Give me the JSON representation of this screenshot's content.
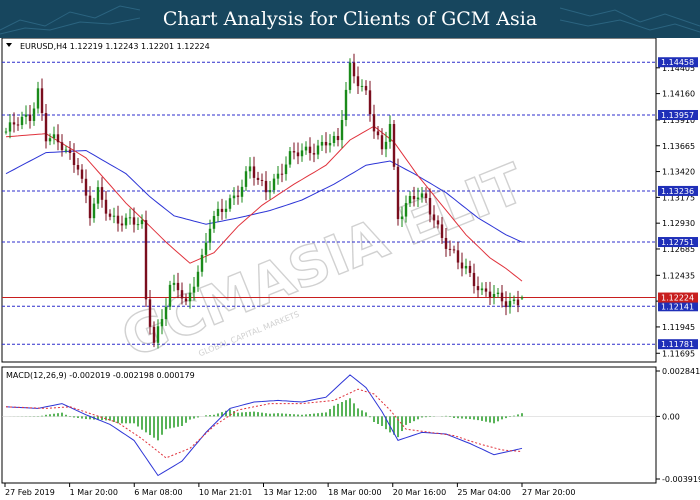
{
  "header": {
    "title": "Chart Analysis for Clients of GCM Asia"
  },
  "watermark": {
    "text": "GCMASIA ELIT",
    "sub": "GLOBAL CAPITAL MARKETS"
  },
  "colors": {
    "banner": "#17465e",
    "bull": "#1a8a1a",
    "bear": "#7a0e1e",
    "ma_fast": "#e0323c",
    "ma_slow": "#2d35d6",
    "level_line": "#2d2dcc",
    "price_line": "#c81e1e",
    "level_label_bg": "#1f2fb8",
    "price_label_bg": "#c81e1e",
    "macd_hist": "#2ea02e",
    "macd_signal": "#e0323c",
    "macd_main": "#2d35d6"
  },
  "chart_data": [
    {
      "type": "candlestick",
      "header": "EURUSD,H4  1.12219 1.12243 1.12201 1.12224",
      "symbol": "EURUSD",
      "timeframe": "H4",
      "ohlc_last": {
        "open": 1.12219,
        "high": 1.12243,
        "low": 1.12201,
        "close": 1.12224
      },
      "ylim": [
        1.1165,
        1.1465
      ],
      "y_ticks": [
        "1.14405",
        "1.14160",
        "1.13910",
        "1.13665",
        "1.13420",
        "1.13175",
        "1.12930",
        "1.12685",
        "1.12435",
        "1.12190",
        "1.11945",
        "1.11695"
      ],
      "x_labels": [
        "27 Feb 2019",
        "1 Mar 20:00",
        "6 Mar 08:00",
        "10 Mar 21:01",
        "13 Mar 12:00",
        "18 Mar 00:00",
        "20 Mar 16:00",
        "25 Mar 04:00",
        "27 Mar 20:00"
      ],
      "levels": [
        {
          "price": 1.14458,
          "label": "1.14458"
        },
        {
          "price": 1.13957,
          "label": "1.13957"
        },
        {
          "price": 1.13236,
          "label": "1.13236"
        },
        {
          "price": 1.12751,
          "label": "1.12751"
        },
        {
          "price": 1.12141,
          "label": "1.12141"
        },
        {
          "price": 1.11781,
          "label": "1.11781"
        }
      ],
      "current_price": {
        "price": 1.12224,
        "label": "1.12224"
      },
      "candle_count": 130,
      "price_path": [
        [
          0,
          1.138
        ],
        [
          6,
          1.1395
        ],
        [
          8,
          1.142
        ],
        [
          10,
          1.1375
        ],
        [
          14,
          1.1365
        ],
        [
          18,
          1.135
        ],
        [
          21,
          1.13
        ],
        [
          23,
          1.132
        ],
        [
          26,
          1.13
        ],
        [
          30,
          1.1295
        ],
        [
          34,
          1.129
        ],
        [
          35,
          1.122
        ],
        [
          37,
          1.1182
        ],
        [
          39,
          1.1205
        ],
        [
          41,
          1.123
        ],
        [
          43,
          1.123
        ],
        [
          45,
          1.1215
        ],
        [
          47,
          1.124
        ],
        [
          49,
          1.126
        ],
        [
          51,
          1.129
        ],
        [
          53,
          1.13
        ],
        [
          55,
          1.131
        ],
        [
          57,
          1.132
        ],
        [
          59,
          1.133
        ],
        [
          61,
          1.1345
        ],
        [
          63,
          1.133
        ],
        [
          65,
          1.1325
        ],
        [
          68,
          1.134
        ],
        [
          71,
          1.1355
        ],
        [
          74,
          1.136
        ],
        [
          77,
          1.1365
        ],
        [
          80,
          1.137
        ],
        [
          83,
          1.1368
        ],
        [
          85,
          1.142
        ],
        [
          86,
          1.1443
        ],
        [
          88,
          1.143
        ],
        [
          90,
          1.1415
        ],
        [
          92,
          1.138
        ],
        [
          94,
          1.136
        ],
        [
          96,
          1.139
        ],
        [
          98,
          1.13
        ],
        [
          100,
          1.131
        ],
        [
          103,
          1.1318
        ],
        [
          105,
          1.1315
        ],
        [
          107,
          1.13
        ],
        [
          109,
          1.128
        ],
        [
          111,
          1.1265
        ],
        [
          113,
          1.1255
        ],
        [
          115,
          1.125
        ],
        [
          117,
          1.124
        ],
        [
          119,
          1.1228
        ],
        [
          121,
          1.1225
        ],
        [
          123,
          1.122
        ],
        [
          125,
          1.1218
        ],
        [
          127,
          1.122
        ],
        [
          129,
          1.1222
        ]
      ],
      "ma_fast": [
        [
          0,
          1.1375
        ],
        [
          10,
          1.1378
        ],
        [
          20,
          1.1355
        ],
        [
          30,
          1.1312
        ],
        [
          36,
          1.129
        ],
        [
          40,
          1.1275
        ],
        [
          46,
          1.1255
        ],
        [
          52,
          1.1265
        ],
        [
          58,
          1.129
        ],
        [
          64,
          1.131
        ],
        [
          72,
          1.133
        ],
        [
          80,
          1.1348
        ],
        [
          86,
          1.1372
        ],
        [
          92,
          1.1385
        ],
        [
          97,
          1.137
        ],
        [
          103,
          1.1338
        ],
        [
          109,
          1.131
        ],
        [
          115,
          1.1282
        ],
        [
          121,
          1.126
        ],
        [
          125,
          1.125
        ],
        [
          129,
          1.1238
        ]
      ],
      "ma_slow": [
        [
          0,
          1.134
        ],
        [
          10,
          1.136
        ],
        [
          20,
          1.1362
        ],
        [
          30,
          1.134
        ],
        [
          36,
          1.1318
        ],
        [
          42,
          1.13
        ],
        [
          50,
          1.1292
        ],
        [
          58,
          1.1298
        ],
        [
          66,
          1.1305
        ],
        [
          74,
          1.1315
        ],
        [
          82,
          1.133
        ],
        [
          90,
          1.1348
        ],
        [
          96,
          1.1352
        ],
        [
          102,
          1.134
        ],
        [
          110,
          1.1322
        ],
        [
          118,
          1.1298
        ],
        [
          125,
          1.1282
        ],
        [
          129,
          1.1275
        ]
      ]
    },
    {
      "type": "macd",
      "header": "MACD(12,26,9) -0.002019 -0.002198 0.000179",
      "params": "12,26,9",
      "values": {
        "main": -0.002019,
        "signal": -0.002198,
        "histogram": 0.000179
      },
      "ylim": [
        -0.003919,
        0.002841
      ],
      "y_ticks": [
        "0.002841",
        "0.00",
        "-0.003919"
      ],
      "main": [
        [
          0,
          0.0006
        ],
        [
          8,
          0.0005
        ],
        [
          14,
          0.0008
        ],
        [
          20,
          0.0001
        ],
        [
          26,
          -0.0005
        ],
        [
          32,
          -0.0015
        ],
        [
          38,
          -0.0037
        ],
        [
          44,
          -0.0028
        ],
        [
          50,
          -0.001
        ],
        [
          56,
          0.0005
        ],
        [
          62,
          0.0009
        ],
        [
          68,
          0.001
        ],
        [
          74,
          0.0009
        ],
        [
          80,
          0.0012
        ],
        [
          86,
          0.0026
        ],
        [
          90,
          0.0018
        ],
        [
          94,
          0.0003
        ],
        [
          98,
          -0.0015
        ],
        [
          104,
          -0.001
        ],
        [
          110,
          -0.0011
        ],
        [
          116,
          -0.0017
        ],
        [
          122,
          -0.0024
        ],
        [
          129,
          -0.002
        ]
      ],
      "signal": [
        [
          0,
          0.0006
        ],
        [
          10,
          0.0005
        ],
        [
          16,
          0.0006
        ],
        [
          22,
          0.0001
        ],
        [
          28,
          -0.0004
        ],
        [
          34,
          -0.0014
        ],
        [
          40,
          -0.0026
        ],
        [
          46,
          -0.002
        ],
        [
          52,
          -0.0006
        ],
        [
          58,
          0.0004
        ],
        [
          66,
          0.0008
        ],
        [
          74,
          0.0008
        ],
        [
          82,
          0.001
        ],
        [
          88,
          0.0017
        ],
        [
          92,
          0.0014
        ],
        [
          96,
          0.0004
        ],
        [
          100,
          -0.0008
        ],
        [
          106,
          -0.001
        ],
        [
          112,
          -0.0012
        ],
        [
          118,
          -0.0017
        ],
        [
          124,
          -0.0021
        ],
        [
          129,
          -0.0022
        ]
      ]
    }
  ]
}
